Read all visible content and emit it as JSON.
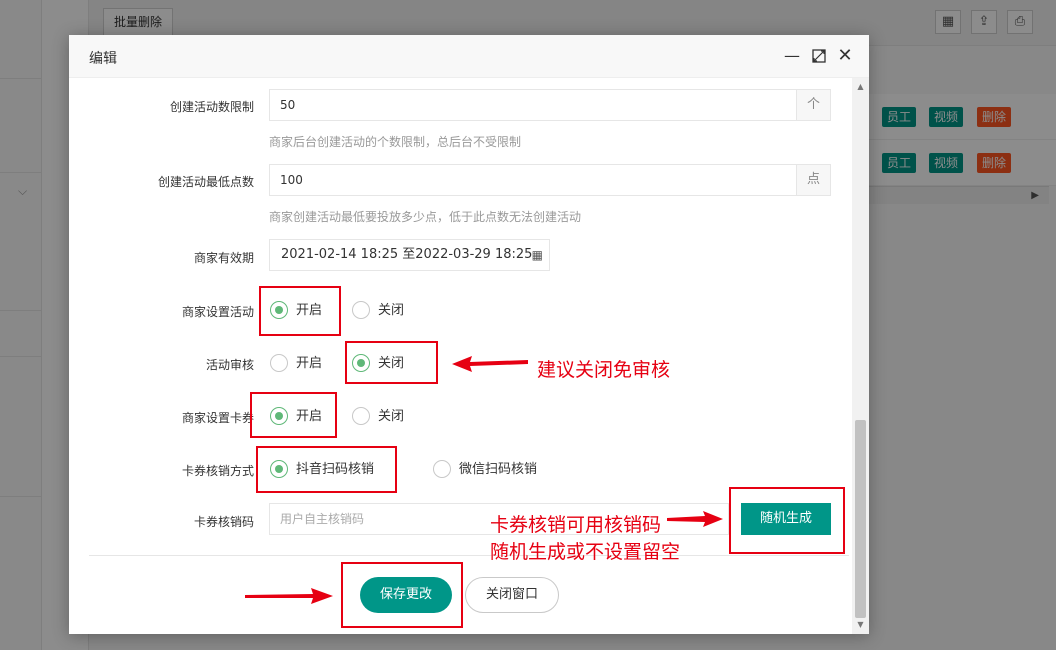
{
  "background": {
    "batch_delete_label": "批量删除",
    "toolbar_icons": [
      "columns-icon",
      "export-icon",
      "print-icon"
    ],
    "rows": [
      {
        "tags": [
          "员工",
          "视频",
          "删除"
        ]
      },
      {
        "tags": [
          "员工",
          "视频",
          "删除"
        ]
      }
    ]
  },
  "modal": {
    "title": "编辑",
    "form": {
      "activity_limit": {
        "label": "创建活动数限制",
        "value": "50",
        "unit": "个",
        "help": "商家后台创建活动的个数限制，总后台不受限制"
      },
      "min_points": {
        "label": "创建活动最低点数",
        "value": "100",
        "unit": "点",
        "help": "商家创建活动最低要投放多少点，低于此点数无法创建活动"
      },
      "validity": {
        "label": "商家有效期",
        "value": "2021-02-14 18:25 至2022-03-29 18:25"
      },
      "set_activity": {
        "label": "商家设置活动",
        "options": [
          "开启",
          "关闭"
        ],
        "selected": "开启"
      },
      "activity_review": {
        "label": "活动审核",
        "options": [
          "开启",
          "关闭"
        ],
        "selected": "关闭"
      },
      "set_coupon": {
        "label": "商家设置卡券",
        "options": [
          "开启",
          "关闭"
        ],
        "selected": "开启"
      },
      "verify_method": {
        "label": "卡券核销方式",
        "options": [
          "抖音扫码核销",
          "微信扫码核销"
        ],
        "selected": "抖音扫码核销"
      },
      "verify_code": {
        "label": "卡券核销码",
        "placeholder": "用户自主核销码",
        "generate_label": "随机生成"
      }
    },
    "buttons": {
      "save": "保存更改",
      "close": "关闭窗口"
    }
  },
  "annotations": {
    "review_note": "建议关闭免审核",
    "code_note_line1": "卡券核销可用核销码",
    "code_note_line2": "随机生成或不设置留空"
  },
  "colors": {
    "primary": "#009688",
    "danger": "#ff5722",
    "radio_checked": "#5fb878",
    "annotation": "#e60012"
  }
}
